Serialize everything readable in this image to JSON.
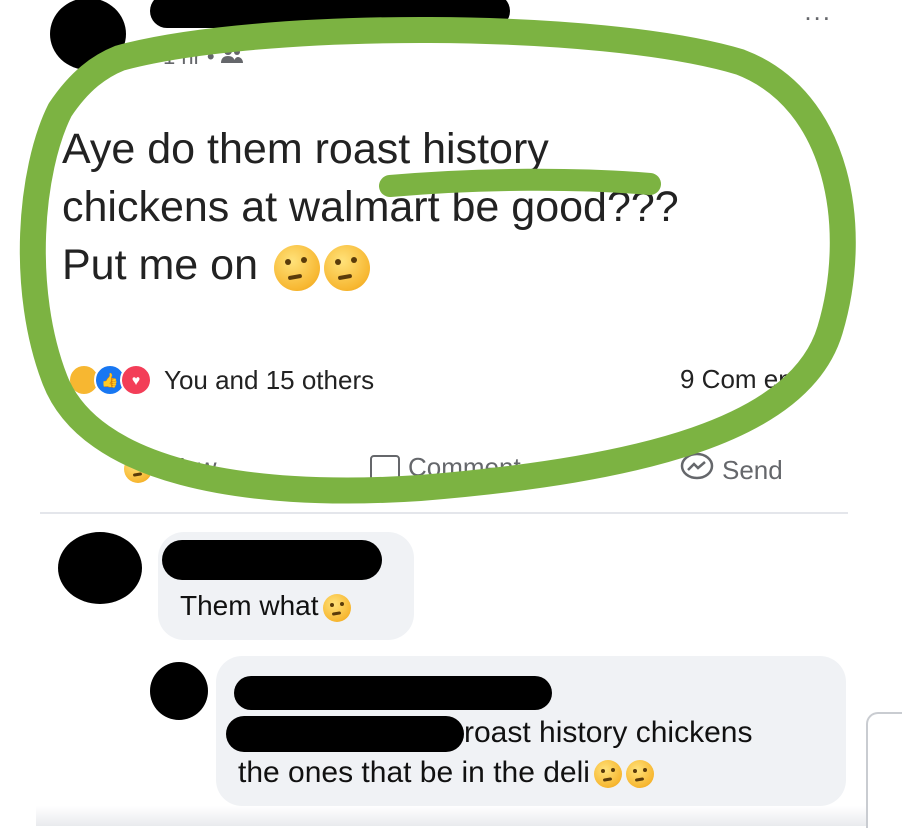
{
  "post": {
    "time": "1 hr",
    "separator": "•",
    "audience_icon": "friends-icon",
    "more_label": "...",
    "text_lines": [
      "Aye do them roast history",
      "chickens at walmart be good???",
      "Put me on"
    ],
    "emoji": "thinking-face-emoji"
  },
  "reactions": {
    "icons": [
      "haha-icon",
      "like-icon",
      "love-icon"
    ],
    "summary": "You and 15 others",
    "comments": "9 Com  ents"
  },
  "actions": {
    "react_label": "Wow",
    "comment_label": "Comment",
    "send_label": "Send"
  },
  "comments": [
    {
      "text": "Them what",
      "emoji": "flushed-face-emoji"
    },
    {
      "line1": "roast history chickens",
      "line2": "the ones that be in the deli",
      "emoji": "thinking-face-emoji"
    }
  ],
  "colors": {
    "highlight": "#7cb342",
    "redaction": "#000000",
    "bubble": "#f0f2f5"
  }
}
